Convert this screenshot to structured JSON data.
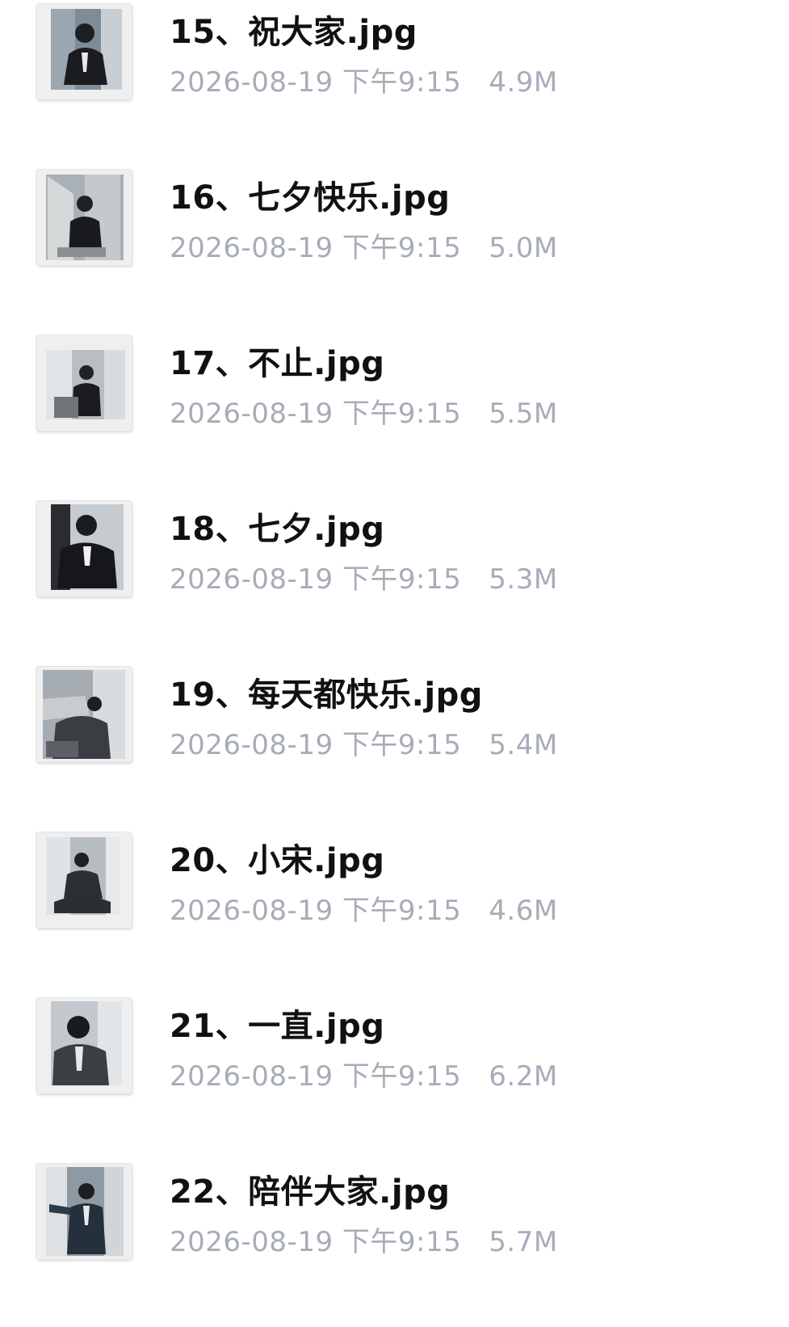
{
  "files": [
    {
      "name": "15、祝大家.jpg",
      "date": "2026-08-19 下午9:15",
      "size": "4.9M",
      "thumbnail": "photo-thumbnail"
    },
    {
      "name": "16、七夕快乐.jpg",
      "date": "2026-08-19 下午9:15",
      "size": "5.0M",
      "thumbnail": "photo-thumbnail"
    },
    {
      "name": "17、不止.jpg",
      "date": "2026-08-19 下午9:15",
      "size": "5.5M",
      "thumbnail": "photo-thumbnail"
    },
    {
      "name": "18、七夕.jpg",
      "date": "2026-08-19 下午9:15",
      "size": "5.3M",
      "thumbnail": "photo-thumbnail"
    },
    {
      "name": "19、每天都快乐.jpg",
      "date": "2026-08-19 下午9:15",
      "size": "5.4M",
      "thumbnail": "photo-thumbnail"
    },
    {
      "name": "20、小宋.jpg",
      "date": "2026-08-19 下午9:15",
      "size": "4.6M",
      "thumbnail": "photo-thumbnail"
    },
    {
      "name": "21、一直.jpg",
      "date": "2026-08-19 下午9:15",
      "size": "6.2M",
      "thumbnail": "photo-thumbnail"
    },
    {
      "name": "22、陪伴大家.jpg",
      "date": "2026-08-19 下午9:15",
      "size": "5.7M",
      "thumbnail": "photo-thumbnail"
    }
  ]
}
